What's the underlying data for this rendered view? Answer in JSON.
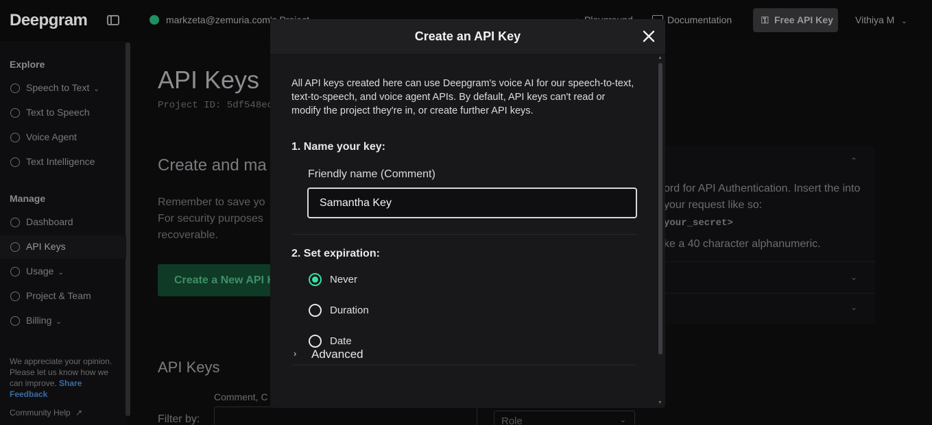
{
  "app": {
    "logo": "Deepgram",
    "project_text": "markzeta@zemuria.com's Project",
    "playground": "Playground",
    "documentation": "Documentation",
    "free_api_key": "Free API Key",
    "user": "Vithiya M"
  },
  "sidebar": {
    "explore_heading": "Explore",
    "manage_heading": "Manage",
    "explore_items": [
      {
        "label": "Speech to Text",
        "icon": "microphone-wave-icon",
        "expandable": true
      },
      {
        "label": "Text to Speech",
        "icon": "microphone-icon"
      },
      {
        "label": "Voice Agent",
        "icon": "headset-icon"
      },
      {
        "label": "Text Intelligence",
        "icon": "brain-icon"
      }
    ],
    "manage_items": [
      {
        "label": "Dashboard",
        "icon": "home-icon"
      },
      {
        "label": "API Keys",
        "icon": "key-icon",
        "active": true
      },
      {
        "label": "Usage",
        "icon": "chart-icon",
        "expandable": true
      },
      {
        "label": "Project & Team",
        "icon": "users-icon"
      },
      {
        "label": "Billing",
        "icon": "dollar-icon",
        "expandable": true
      }
    ],
    "feedback_text": "We appreciate your opinion. Please let us know how we can improve.",
    "feedback_link": "Share Feedback",
    "community_help": "Community Help"
  },
  "page": {
    "title": "API Keys",
    "project_id": "Project ID: 5df548ec",
    "section_title": "Create and ma",
    "section_text": "Remember to save yo For security purposes recoverable.",
    "create_button": "Create a New API Key",
    "keys_title": "API Keys",
    "comment_label": "Comment, C",
    "filter_label": "Filter by:",
    "role_placeholder": "Role",
    "accordion_text": "ord for API Authentication. Insert the into your request like so:",
    "accordion_code": "your_secret>",
    "accordion_text2": "ke a 40 character alphanumeric."
  },
  "modal": {
    "title": "Create an API Key",
    "intro": "All API keys created here can use Deepgram's voice AI for our speech-to-text, text-to-speech, and voice agent APIs. By default, API keys can't read or modify the project they're in, or create further API keys.",
    "step1": "1. Name your key:",
    "field_label": "Friendly name (Comment)",
    "name_value": "Samantha Key",
    "step2": "2. Set expiration:",
    "expiration_options": [
      {
        "label": "Never",
        "selected": true
      },
      {
        "label": "Duration",
        "selected": false
      },
      {
        "label": "Date",
        "selected": false
      }
    ],
    "advanced": "Advanced"
  },
  "colors": {
    "accent": "#38e0a0",
    "modal_bg": "#18181b",
    "page_bg": "#0b0b0c"
  }
}
